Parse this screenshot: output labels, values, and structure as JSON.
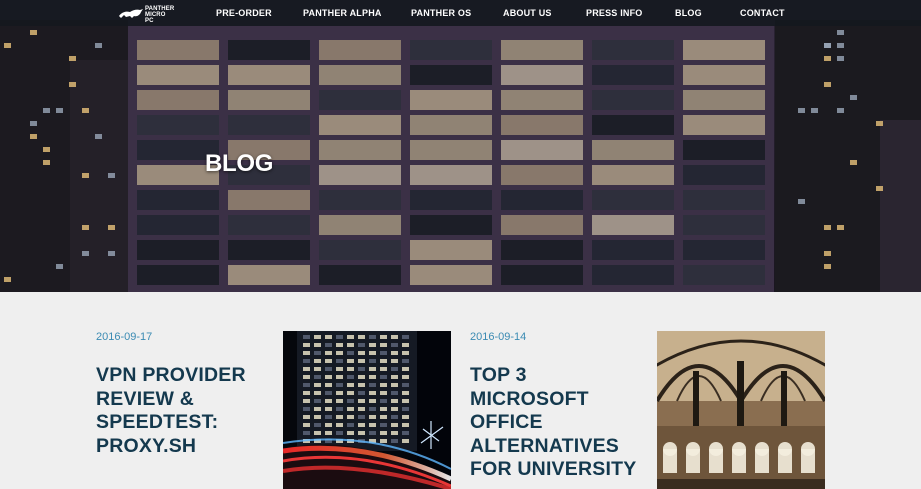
{
  "brand": {
    "logo_line1": "PANTHER",
    "logo_line2": "MICRO PC"
  },
  "nav": {
    "items": [
      {
        "label": "PRE-ORDER"
      },
      {
        "label": "PANTHER ALPHA"
      },
      {
        "label": "PANTHER OS"
      },
      {
        "label": "ABOUT US"
      },
      {
        "label": "PRESS INFO"
      },
      {
        "label": "BLOG"
      },
      {
        "label": "CONTACT"
      }
    ]
  },
  "hero": {
    "title": "BLOG"
  },
  "posts": [
    {
      "date": "2016-09-17",
      "title": "VPN PROVIDER REVIEW & SPEEDTEST: PROXY.SH"
    },
    {
      "date": "2016-09-14",
      "title": "TOP 3 MICROSOFT OFFICE ALTERNATIVES FOR UNIVERSITY"
    }
  ],
  "colors": {
    "nav_bg": "#14181e",
    "date": "#3b8bb3",
    "post_title": "#14394e",
    "page_bg": "#efefef"
  }
}
